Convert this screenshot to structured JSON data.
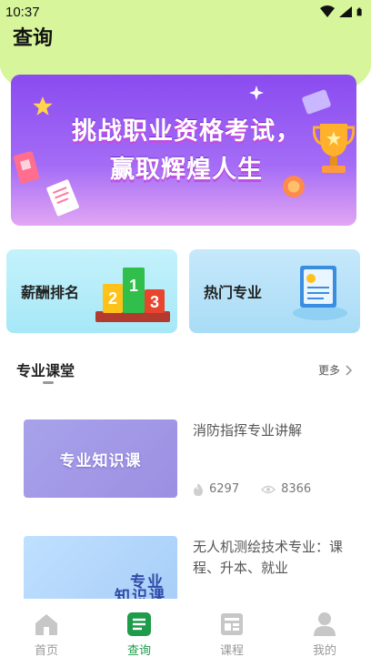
{
  "status": {
    "time": "10:37"
  },
  "page": {
    "title": "查询"
  },
  "banner": {
    "line1": "挑战职业资格考试，",
    "line2": "赢取辉煌人生"
  },
  "cards": [
    {
      "label": "薪酬排名",
      "icon": "podium-icon"
    },
    {
      "label": "热门专业",
      "icon": "certificate-icon"
    }
  ],
  "podium": {
    "left": "2",
    "center": "1",
    "right": "3"
  },
  "section": {
    "title": "专业课堂",
    "more": "更多"
  },
  "courses": [
    {
      "title": "消防指挥专业讲解",
      "thumb_text": "专业知识课",
      "likes": "6297",
      "views": "8366"
    },
    {
      "title": "无人机测绘技术专业：课程、升本、就业",
      "thumb_text_1": "专业",
      "thumb_text_2": "知识课"
    }
  ],
  "tabs": [
    {
      "label": "首页",
      "icon": "home-icon"
    },
    {
      "label": "查询",
      "icon": "search-doc-icon",
      "active": true
    },
    {
      "label": "课程",
      "icon": "course-icon"
    },
    {
      "label": "我的",
      "icon": "user-icon"
    }
  ],
  "colors": {
    "accent": "#1f9b4c",
    "header_bg": "#d7f59a",
    "banner_purple": "#8a4bf0"
  }
}
